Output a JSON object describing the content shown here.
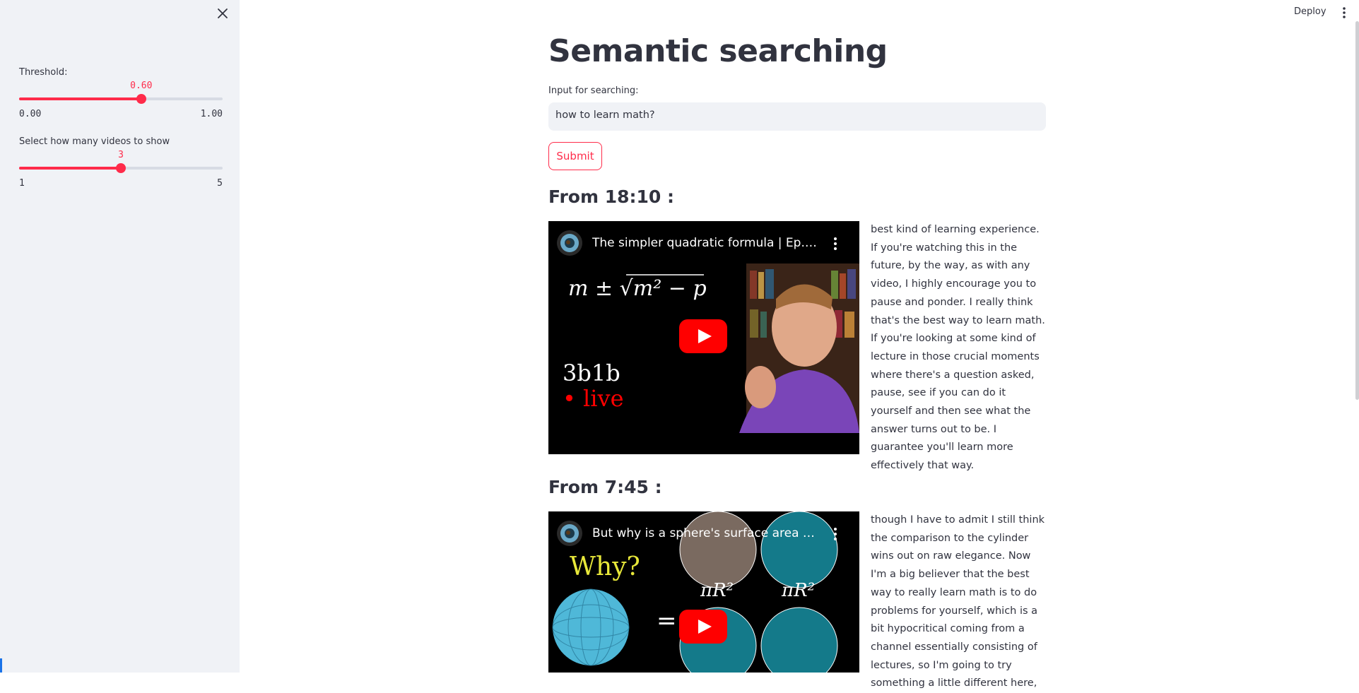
{
  "sidebar": {
    "threshold": {
      "label": "Threshold:",
      "value": 0.6,
      "value_text": "0.60",
      "min_text": "0.00",
      "max_text": "1.00"
    },
    "video_count": {
      "label": "Select how many videos to show",
      "value": 3,
      "value_text": "3",
      "min_text": "1",
      "max_text": "5"
    }
  },
  "header": {
    "deploy_label": "Deploy"
  },
  "main": {
    "title": "Semantic searching",
    "input_label": "Input for searching:",
    "input_value": "how to learn math?",
    "submit_label": "Submit",
    "results": [
      {
        "heading": "From 18:10 :",
        "video_title": "The simpler quadratic formula | Ep. 1 ...",
        "thumb_lines": [
          "3b1b",
          "live"
        ],
        "transcript": "best kind of learning experience. If you're watching this in the future, by the way, as with any video, I highly encourage you to pause and ponder. I really think that's the best way to learn math. If you're looking at some kind of lecture in those crucial moments where there's a question asked, pause, see if you can do it yourself and then see what the answer turns out to be. I guarantee you'll learn more effectively that way."
      },
      {
        "heading": "From 7:45 :",
        "video_title": "But why is a sphere's surface area fou...",
        "thumb_lines": [
          "Why?"
        ],
        "transcript": "though I have to admit I still think the comparison to the cylinder wins out on raw elegance. Now I'm a big believer that the best way to really learn math is to do problems for yourself, which is a bit hypocritical coming from a channel essentially consisting of lectures, so I'm going to try something a little different here,"
      }
    ]
  },
  "colors": {
    "accent": "#ff2b4a",
    "sidebar_bg": "#f0f2f6",
    "text": "#31333f",
    "youtube_red": "#ff0000"
  }
}
